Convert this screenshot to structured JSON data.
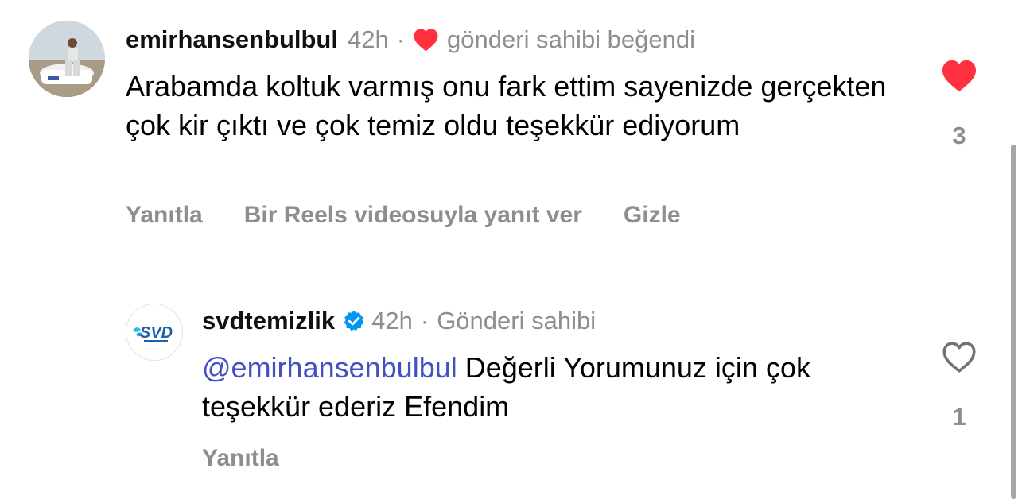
{
  "comment": {
    "username": "emirhansenbulbul",
    "time": "42h",
    "separator": "·",
    "liked_by_author_text": "gönderi sahibi beğendi",
    "text": "Arabamda koltuk varmış onu fark ettim sayenizde gerçekten çok kir çıktı ve çok temiz oldu teşekkür ediyorum",
    "actions": {
      "reply": "Yanıtla",
      "reels_reply": "Bir Reels videosuyla yanıt ver",
      "hide": "Gizle"
    },
    "likes": "3",
    "liked": true,
    "icons": {
      "author_like": "heart-filled-icon",
      "like": "heart-filled-icon"
    }
  },
  "reply": {
    "username": "svdtemizlik",
    "verified": true,
    "time": "42h",
    "separator": "·",
    "role": "Gönderi sahibi",
    "mention": "@emirhansenbulbul",
    "text": " Değerli Yorumunuz için çok teşekkür ederiz Efendim",
    "actions": {
      "reply": "Yanıtla"
    },
    "likes": "1",
    "liked": false,
    "icons": {
      "verified": "verified-badge-icon",
      "like": "heart-outline-icon"
    }
  },
  "colors": {
    "like_red": "#ff3040",
    "meta_gray": "#8e8e8e",
    "mention_blue": "#4150c5",
    "verified_blue": "#0095f6"
  }
}
